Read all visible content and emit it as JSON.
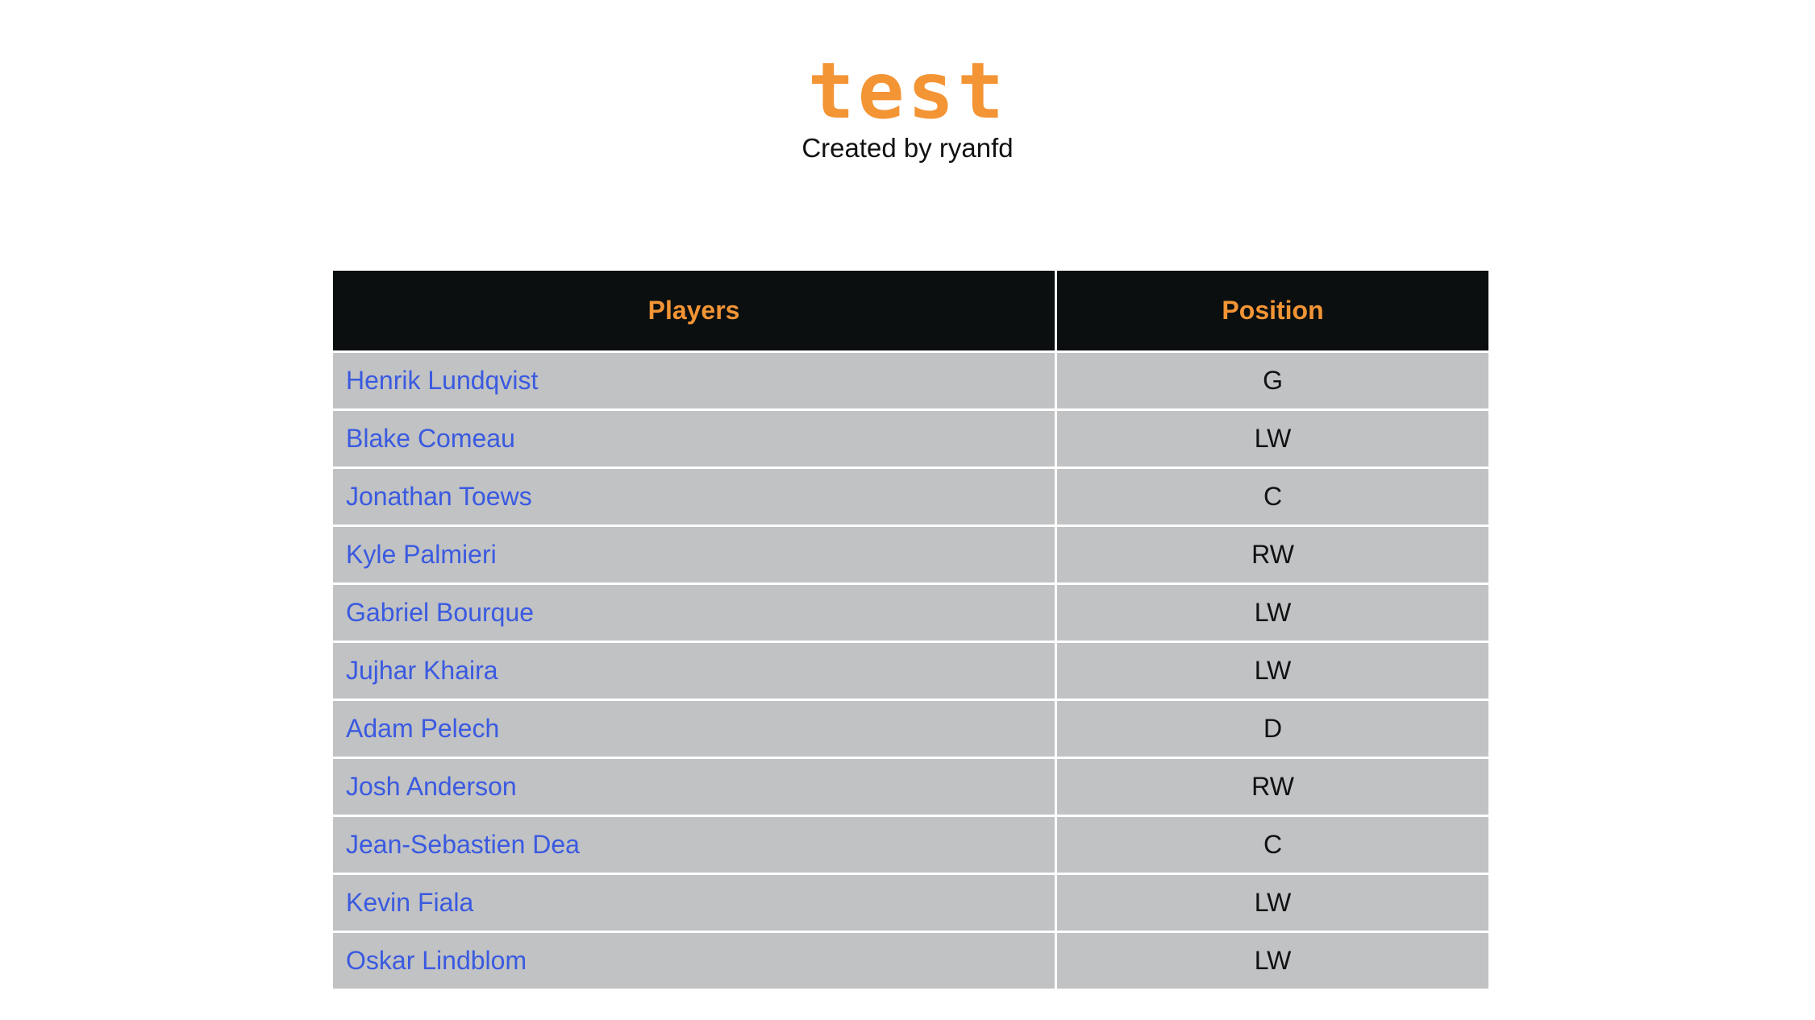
{
  "header": {
    "title": "test",
    "subtitle": "Created by ryanfd"
  },
  "colors": {
    "title": "#f39435",
    "header_bg": "#0b0f0f",
    "header_text": "#f39435",
    "row_bg": "#c1c2c4",
    "link": "#3a5ae0",
    "cell_text": "#111111"
  },
  "table": {
    "columns": [
      "Players",
      "Position"
    ],
    "rows": [
      {
        "player": "Henrik Lundqvist",
        "position": "G"
      },
      {
        "player": "Blake Comeau",
        "position": "LW"
      },
      {
        "player": "Jonathan Toews",
        "position": "C"
      },
      {
        "player": "Kyle Palmieri",
        "position": "RW"
      },
      {
        "player": "Gabriel Bourque",
        "position": "LW"
      },
      {
        "player": "Jujhar Khaira",
        "position": "LW"
      },
      {
        "player": "Adam Pelech",
        "position": "D"
      },
      {
        "player": "Josh Anderson",
        "position": "RW"
      },
      {
        "player": "Jean-Sebastien Dea",
        "position": "C"
      },
      {
        "player": "Kevin Fiala",
        "position": "LW"
      },
      {
        "player": "Oskar Lindblom",
        "position": "LW"
      }
    ]
  }
}
